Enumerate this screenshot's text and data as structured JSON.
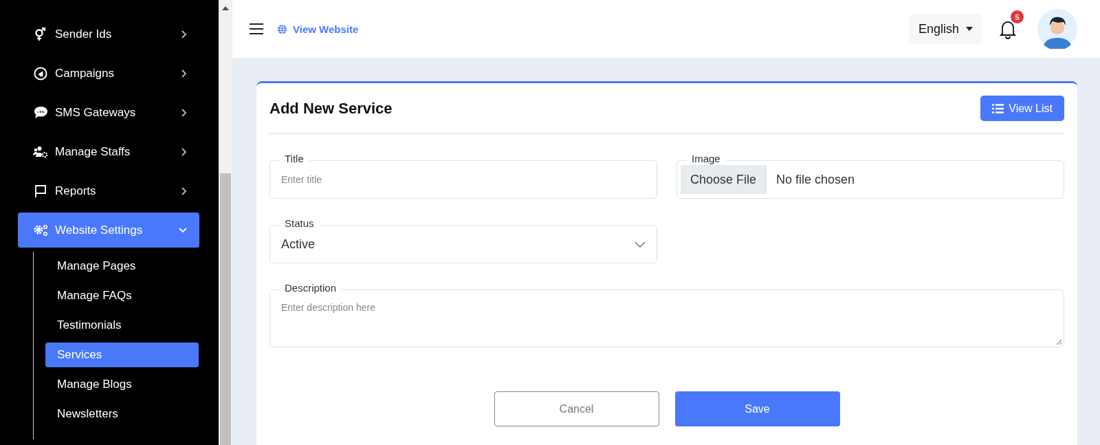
{
  "sidebar": {
    "items": [
      {
        "label": "Sender Ids",
        "expanded": false,
        "selected": false
      },
      {
        "label": "Campaigns",
        "expanded": false,
        "selected": false
      },
      {
        "label": "SMS Gateways",
        "expanded": false,
        "selected": false
      },
      {
        "label": "Manage Staffs",
        "expanded": false,
        "selected": false
      },
      {
        "label": "Reports",
        "expanded": false,
        "selected": false
      },
      {
        "label": "Website Settings",
        "expanded": true,
        "selected": true,
        "children": [
          {
            "label": "Manage Pages",
            "selected": false
          },
          {
            "label": "Manage FAQs",
            "selected": false
          },
          {
            "label": "Testimonials",
            "selected": false
          },
          {
            "label": "Services",
            "selected": true
          },
          {
            "label": "Manage Blogs",
            "selected": false
          },
          {
            "label": "Newsletters",
            "selected": false
          }
        ]
      }
    ]
  },
  "header": {
    "view_website": "View Website",
    "language": "English",
    "notification_count": "5"
  },
  "form": {
    "title": "Add New Service",
    "view_list": "View List",
    "fields": [
      {
        "kind": "text",
        "label": "Title",
        "placeholder": "Enter title"
      },
      {
        "kind": "file",
        "label": "Image",
        "button": "Choose File",
        "value": "No file chosen"
      },
      {
        "kind": "select",
        "label": "Status",
        "value": "Active"
      },
      {
        "kind": "textarea",
        "label": "Description",
        "placeholder": "Enter description here"
      }
    ],
    "buttons": [
      {
        "kind": "secondary",
        "label": "Cancel"
      },
      {
        "kind": "primary",
        "label": "Save"
      }
    ]
  }
}
